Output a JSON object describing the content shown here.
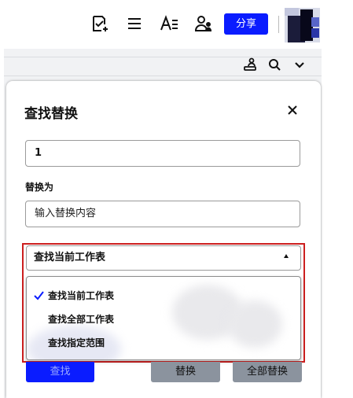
{
  "toolbar": {
    "icons": [
      "edit-add-icon",
      "menu-icon",
      "text-format-icon",
      "collaborators-icon"
    ],
    "share_label": "分享"
  },
  "sheet_toolbar": {
    "icons": [
      "user-cell-icon",
      "search-icon",
      "chevron-down-icon"
    ]
  },
  "panel": {
    "title": "查找替换",
    "find_value": "1",
    "replace_label": "替换为",
    "replace_placeholder": "输入替换内容",
    "scope": {
      "selected": "查找当前工作表",
      "options": [
        "查找当前工作表",
        "查找全部工作表",
        "查找指定范围"
      ]
    },
    "buttons": {
      "find": "查找",
      "replace": "替换",
      "replace_all": "全部替换"
    }
  },
  "colors": {
    "accent": "#0a1cff",
    "highlight_border": "#cc1f1f",
    "disabled_button": "#8b939e"
  }
}
